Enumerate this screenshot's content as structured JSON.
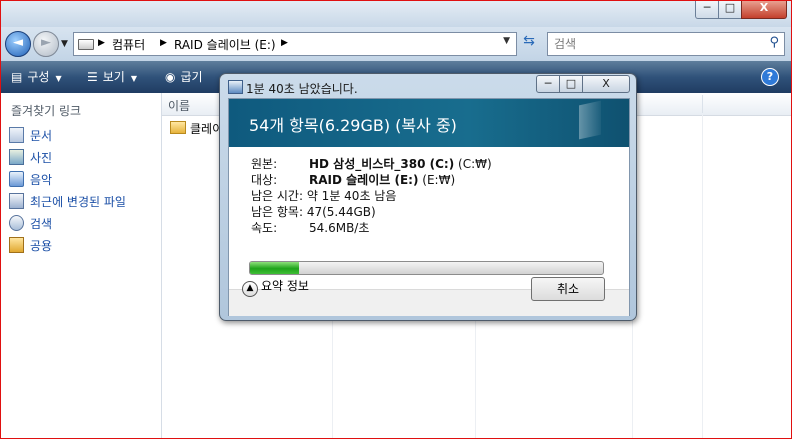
{
  "window": {
    "min_glyph": "─",
    "max_glyph": "□",
    "close_glyph": "X"
  },
  "address": {
    "back_glyph": "◄",
    "fwd_glyph": "►",
    "crumbs": [
      "컴퓨터",
      "RAID 슬레이브 (E:)"
    ],
    "sep": "▶",
    "dropdown_glyph": "▼"
  },
  "search": {
    "placeholder": "검색"
  },
  "toolbar": {
    "organize": "구성",
    "views": "보기",
    "burn": "굽기",
    "help": "?"
  },
  "nav": {
    "heading": "즐겨찾기 링크",
    "items": [
      {
        "label": "문서",
        "icon": "documents-icon"
      },
      {
        "label": "사진",
        "icon": "pictures-icon"
      },
      {
        "label": "음악",
        "icon": "music-icon"
      },
      {
        "label": "최근에 변경된 파일",
        "icon": "recent-icon"
      },
      {
        "label": "검색",
        "icon": "search-folder-icon"
      },
      {
        "label": "공용",
        "icon": "public-folder-icon"
      }
    ]
  },
  "files": {
    "columns": {
      "name": "이름"
    },
    "rows": [
      {
        "name": "클레이"
      }
    ]
  },
  "copy_dialog": {
    "title": "1분 40초 남았습니다.",
    "heading": "54개 항목(6.29GB) (복사 중)",
    "from_label": "원본:",
    "from_bold": "HD 삼성_비스타_380 (C:)",
    "from_rest": "(C:₩)",
    "to_label": "대상:",
    "to_bold": "RAID 슬레이브 (E:)",
    "to_rest": "(E:₩)",
    "time_left": "남은 시간: 약 1분 40초 남음",
    "items_left": "남은 항목: 47(5.44GB)",
    "speed": "속도:",
    "speed_value": "54.6MB/초",
    "progress": 0.14,
    "details": "요약 정보",
    "cancel": "취소",
    "colors": {
      "band": "#186d8e",
      "progress": "#1ea31a"
    }
  }
}
